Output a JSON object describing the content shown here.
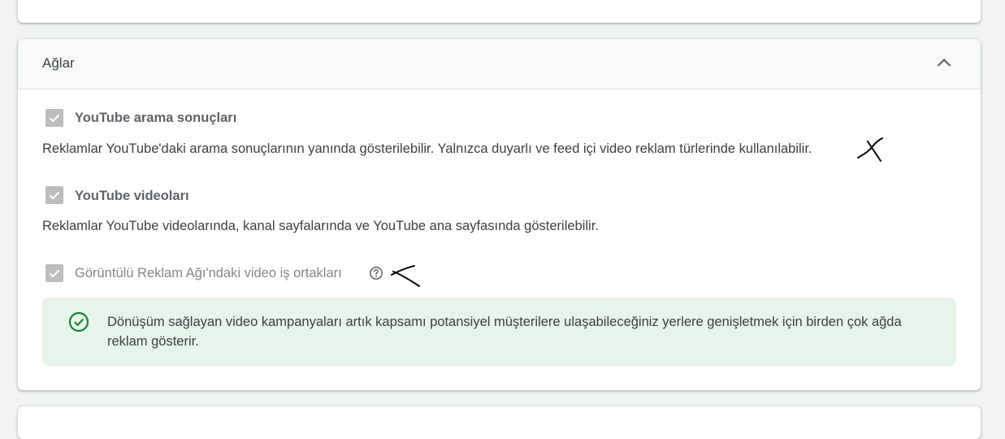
{
  "networks_panel": {
    "title": "Ağlar",
    "collapse_icon": "chevron-up-icon",
    "options": [
      {
        "label": "YouTube arama sonuçları",
        "checked": true,
        "description": "Reklamlar YouTube'daki arama sonuçlarının yanında gösterilebilir. Yalnızca duyarlı ve feed içi video reklam türlerinde kullanılabilir."
      },
      {
        "label": "YouTube videoları",
        "checked": true,
        "description": "Reklamlar YouTube videolarında, kanal sayfalarında ve YouTube ana sayfasında gösterilebilir."
      },
      {
        "label": "Görüntülü Reklam Ağı'ndaki video iş ortakları",
        "checked": true,
        "help_icon": "help-circle-icon"
      }
    ],
    "info_box": {
      "icon": "check-circle-icon",
      "text": "Dönüşüm sağlayan video kampanyaları artık kapsamı potansiyel müşterilere ulaşabileceğiniz yerlere genişletmek için birden çok ağda reklam gösterir."
    }
  },
  "colors": {
    "checkbox_disabled": "#bdbdbd",
    "info_background": "#e6f4ea",
    "success_green": "#188038",
    "header_background": "#f8f9fa"
  }
}
